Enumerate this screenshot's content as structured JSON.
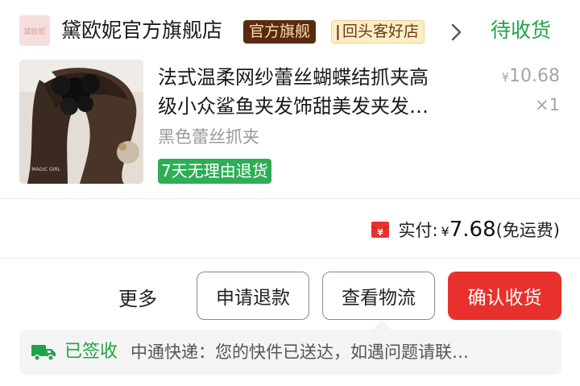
{
  "shop": {
    "logo_text": "黛欧妮",
    "name": "黛欧妮官方旗舰店",
    "badge_flagship": "官方旗舰",
    "badge_repeat": "回头客好店",
    "status": "待收货",
    "status_color": "#23a249"
  },
  "product": {
    "title_line1": "法式温柔网纱蕾丝蝴蝶结抓夹高",
    "title_line2": "级小众鲨鱼夹发饰甜美发夹发…",
    "spec": "黑色蕾丝抓夹",
    "return_tag": "7天无理由退货",
    "price_symbol": "¥",
    "price": "10.68",
    "quantity": "×1",
    "thumb_watermark": "♡MAGIC GIRL"
  },
  "payment": {
    "label": "实付:",
    "symbol": "¥",
    "amount": "7.68",
    "note": "(免运费)",
    "icon": "red-envelope-icon"
  },
  "actions": {
    "more": "更多",
    "refund": "申请退款",
    "logistics": "查看物流",
    "confirm": "确认收货",
    "accent": "#e8312c"
  },
  "logistics": {
    "status": "已签收",
    "text": "中通快递：您的快件已送达，如遇问题请联…",
    "icon": "truck-icon"
  }
}
